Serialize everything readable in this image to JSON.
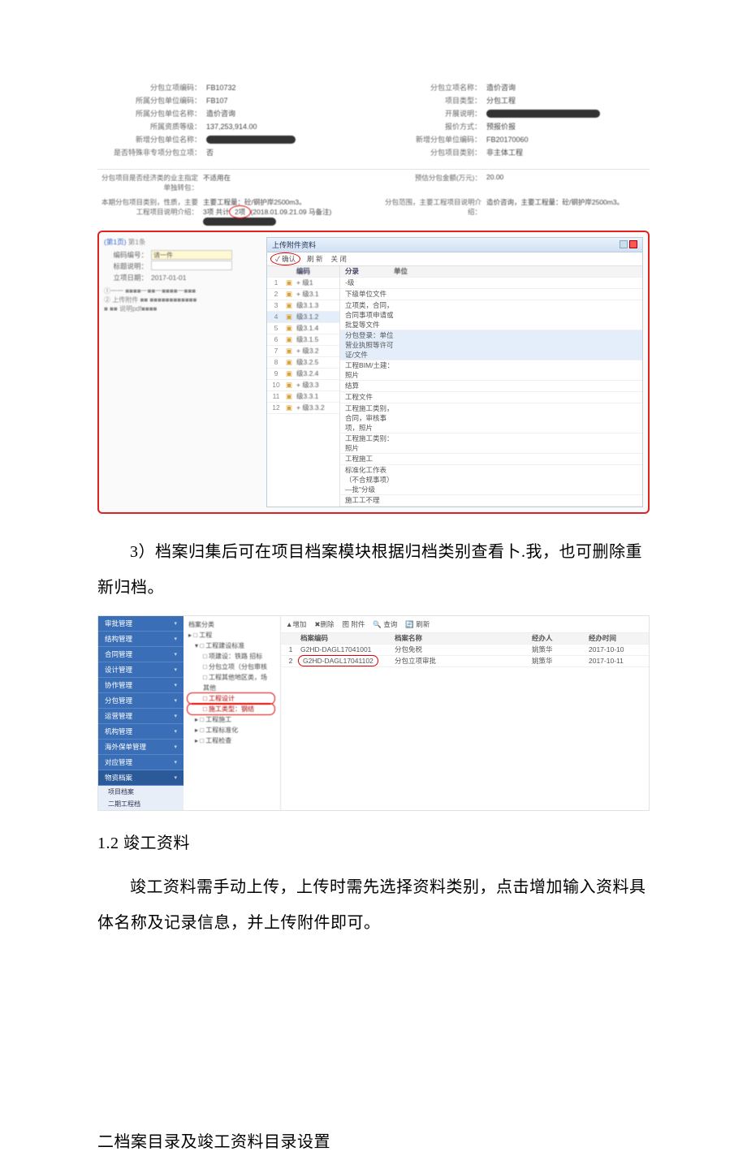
{
  "shot1": {
    "left": [
      {
        "label": "分包立项编码：",
        "value": "FB10732"
      },
      {
        "label": "所属分包单位编码：",
        "value": "FB107"
      },
      {
        "label": "所属分包单位名称：",
        "value": "造价咨询"
      },
      {
        "label": "所属资质等级：",
        "value": "137,253,914.00"
      },
      {
        "label": "新增分包单位名称：",
        "value_redact": 110
      },
      {
        "label": "是否特殊非专项分包立项：",
        "value": "否"
      }
    ],
    "right": [
      {
        "label": "分包立项名称：",
        "value": "造价咨询"
      },
      {
        "label": "项目类型：",
        "value": "分包工程"
      },
      {
        "label": "开展说明：",
        "value_redact": 140
      },
      {
        "label": "报价方式：",
        "value": "预报价报"
      },
      {
        "label": "新增分包单位编码：",
        "value": "FB20170060"
      },
      {
        "label": "分包项目类别：",
        "value": "非主体工程"
      }
    ],
    "memo_left_label": "分包项目是否经济类的业主指定单独转包：",
    "memo_left_value": "不适用在",
    "memo_left_label2": "本期分包项目类别，性质，主要工程项目说明介绍：",
    "memo_left_value2": "主要工程量：砼/钢护岸2500m3。",
    "memo_left_value3": "3项 共计",
    "memo_left_circle": "2项",
    "memo_left_tail": "(2018.01.09.21.09 马备注)",
    "memo_left_tail_redact": 90,
    "memo_right_label": "预估分包金额(万元)：",
    "memo_right_value": "20.00",
    "memo_right_label2": "分包范围，主要工程项目说明介绍：",
    "memo_right_value2": "造价咨询，主要工程量：砼/钢护岸2500m3。",
    "popup_left": {
      "tab": "第1页",
      "rows": [
        {
          "label": "编码编号：",
          "type": "y",
          "text": "请一件"
        },
        {
          "label": "标题说明：",
          "type": "w"
        },
        {
          "label": "立项日期：",
          "text": "2017-01-01"
        }
      ],
      "notes": [
        "①一一  ■■■■一■■一■■■■一■■■",
        "② 上传附件  ■■  ■■■■■■■■■■■■",
        "■ ■■  说明pdf­■■■■"
      ]
    },
    "popup_right": {
      "title": "上传附件资料",
      "toolbar": [
        "✓ 确认",
        "刷 新",
        "关 闭"
      ],
      "toolbar_sel": 0,
      "left_head": "编码",
      "right_head1": "分录",
      "right_head2": "单位",
      "rows": [
        {
          "n": 1,
          "code": "+ 级1",
          "d1": "-级",
          "d2": ""
        },
        {
          "n": 2,
          "code": "+ 级3.1",
          "d1": "下级单位文件",
          "d2": ""
        },
        {
          "n": 3,
          "code": "级3.1.3",
          "d1": "立项类，合同，合同事项申请或批复等文件",
          "d2": ""
        },
        {
          "n": 4,
          "code": "级3.1.2",
          "d1": "分包登录：单位营业执照等许可证/文件",
          "d2": "",
          "hl": true
        },
        {
          "n": 5,
          "code": "级3.1.4",
          "d1": "工程BIM/土建：照片",
          "d2": ""
        },
        {
          "n": 6,
          "code": "级3.1.5",
          "d1": "结算",
          "d2": ""
        },
        {
          "n": 7,
          "code": "+ 级3.2",
          "d1": "工程文件",
          "d2": ""
        },
        {
          "n": 8,
          "code": "级3.2.5",
          "d1": "工程施工类别，合同，审核事项，照片",
          "d2": ""
        },
        {
          "n": 9,
          "code": "级3.2.4",
          "d1": "工程施工类别：照片",
          "d2": ""
        },
        {
          "n": 10,
          "code": "+ 级3.3",
          "d1": "工程施工",
          "d2": ""
        },
        {
          "n": 11,
          "code": "级3.3.1",
          "d1": "标准化工作表（不合规事项）—批\"分级",
          "d2": ""
        },
        {
          "n": 12,
          "code": "+ 级3.3.2",
          "d1": "施工工不理",
          "d2": ""
        }
      ]
    }
  },
  "para1": "3）档案归集后可在项目档案模块根据归档类别查看卜.我，也可删除重新归档。",
  "shot2": {
    "sidebar": [
      "审批管理",
      "结构管理",
      "合同管理",
      "设计管理",
      "协作管理",
      "分包管理",
      "运营管理",
      "机构管理",
      "海外保单管理",
      "对应管理"
    ],
    "sidebar_sel": "物资档案",
    "sidebar_sub": [
      "项目档案",
      "二期工程档"
    ],
    "tree": [
      {
        "t": "档案分类",
        "lv": 0
      },
      {
        "t": "▸ □ 工程",
        "lv": 0
      },
      {
        "t": "▾ □ 工程建设标准",
        "lv": 1
      },
      {
        "t": "□ 项建设：铁路 招标",
        "lv": 2
      },
      {
        "t": "□ 分包立项（分包审核",
        "lv": 2
      },
      {
        "t": "□ 工程其他地区类，场",
        "lv": 2
      },
      {
        "t": "其他",
        "lv": 2
      },
      {
        "t": "□ 工程设计",
        "lv": 2,
        "hl": true
      },
      {
        "t": "□ 施工类型：钢结",
        "lv": 2,
        "hl": true
      },
      {
        "t": "▸ □ 工程施工",
        "lv": 1
      },
      {
        "t": "▸ □ 工程标准化",
        "lv": 1
      },
      {
        "t": "▸ □ 工程检查",
        "lv": 1
      }
    ],
    "toolbar": [
      "▲增加",
      "✖删除",
      "图 附件",
      "🔍 查询",
      "🔄 刷新"
    ],
    "grid_head": [
      "",
      "档案编码",
      "档案名称",
      "经办人",
      "经办时间"
    ],
    "rows": [
      {
        "code": "G2HD-DAGL17041001",
        "name": "分包免税",
        "by": "姚策华",
        "date": "2017-10-10"
      },
      {
        "code": "G2HD-DAGL17041102",
        "name": "分包立项审批",
        "by": "姚策华",
        "date": "2017-10-11",
        "circ": true
      }
    ]
  },
  "heading_1_2": "1.2 竣工资料",
  "para2": "竣工资料需手动上传，上传时需先选择资料类别，点击增加输入资料具体名称及记录信息，并上传附件即可。",
  "heading_2": "二档案目录及竣工资料目录设置"
}
